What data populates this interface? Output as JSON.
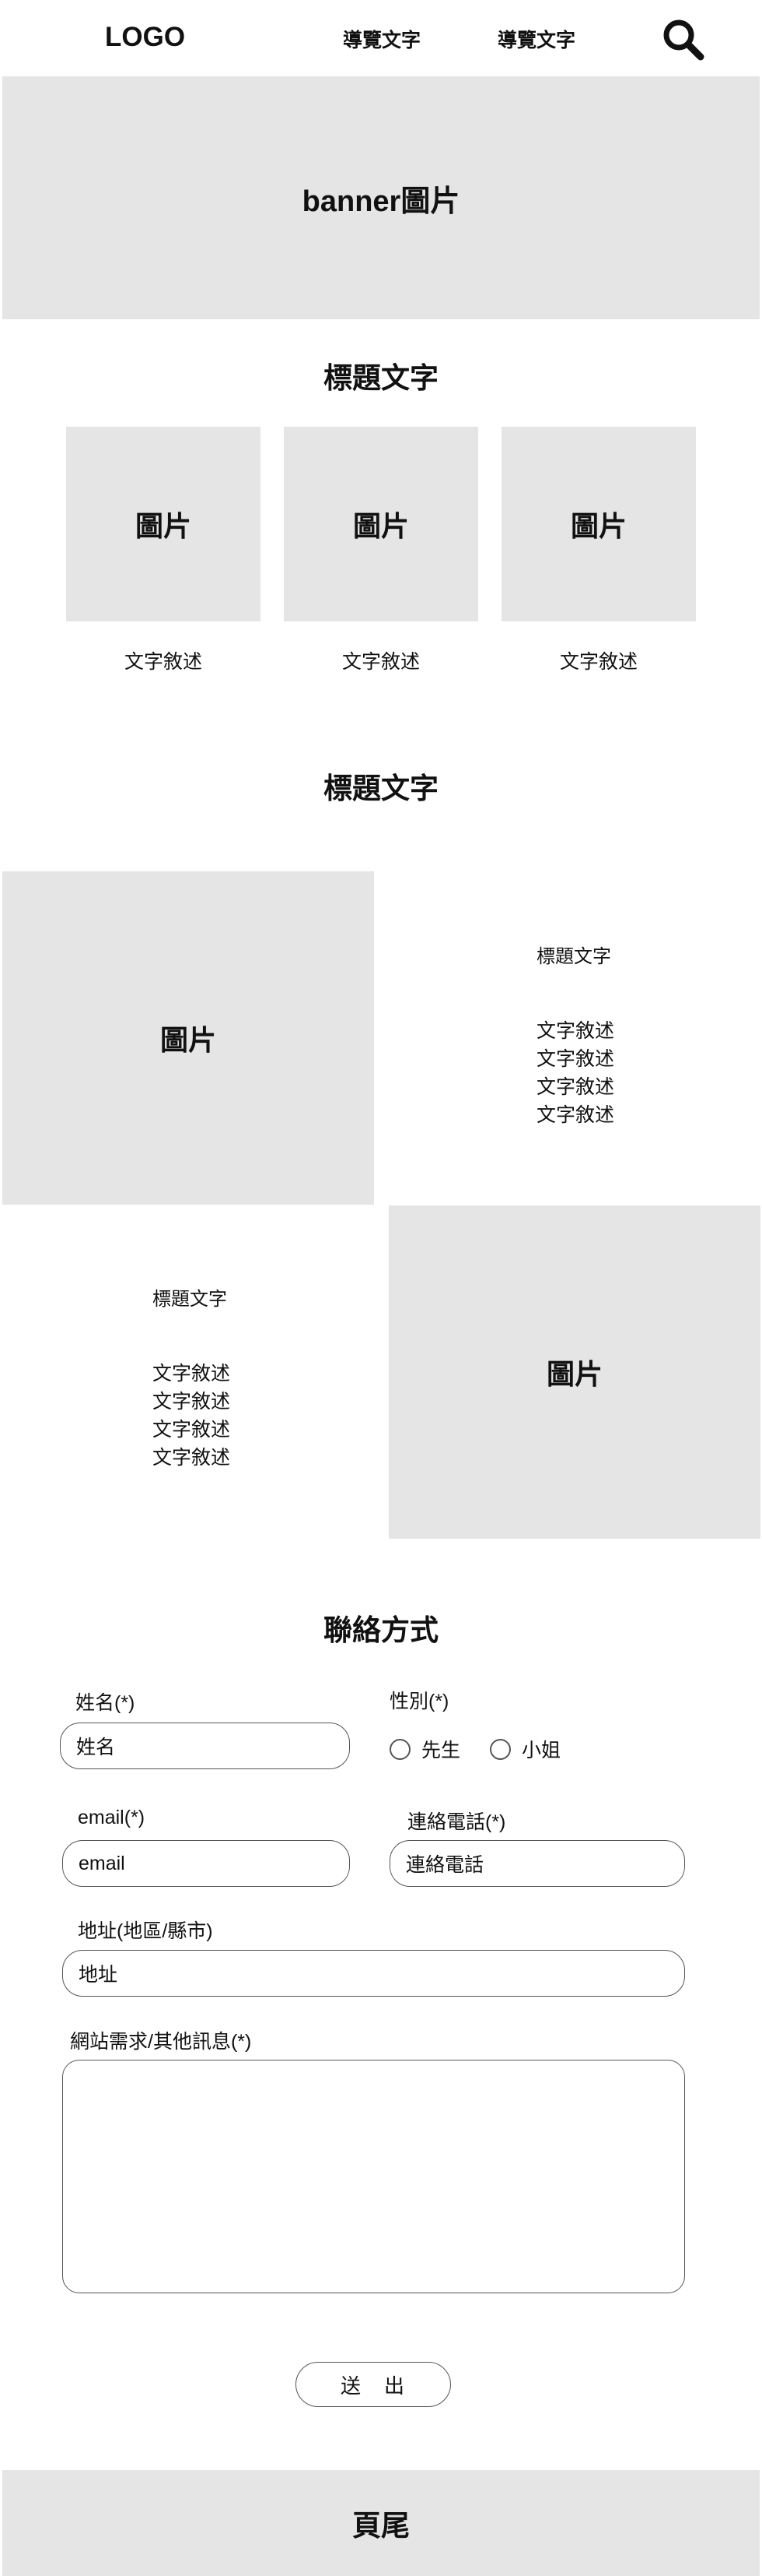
{
  "header": {
    "logo": "LOGO",
    "nav": [
      "導覽文字",
      "導覽文字"
    ],
    "search_icon": "search-icon"
  },
  "banner": {
    "label": "banner圖片"
  },
  "section1": {
    "title": "標題文字",
    "cards": [
      {
        "image_label": "圖片",
        "text": "文字敘述"
      },
      {
        "image_label": "圖片",
        "text": "文字敘述"
      },
      {
        "image_label": "圖片",
        "text": "文字敘述"
      }
    ]
  },
  "section2": {
    "title": "標題文字",
    "rows": [
      {
        "image_label": "圖片",
        "title": "標題文字",
        "lines": [
          "文字敘述",
          "文字敘述",
          "文字敘述",
          "文字敘述"
        ]
      },
      {
        "image_label": "圖片",
        "title": "標題文字",
        "lines": [
          "文字敘述",
          "文字敘述",
          "文字敘述",
          "文字敘述"
        ]
      }
    ]
  },
  "contact": {
    "title": "聯絡方式",
    "name": {
      "label": "姓名(*)",
      "placeholder": "姓名"
    },
    "gender": {
      "label": "性別(*)",
      "options": [
        "先生",
        "小姐"
      ]
    },
    "email": {
      "label": "email(*)",
      "placeholder": "email"
    },
    "phone": {
      "label": "連絡電話(*)",
      "placeholder": "連絡電話"
    },
    "address": {
      "label": "地址(地區/縣市)",
      "placeholder": "地址"
    },
    "message": {
      "label": "網站需求/其他訊息(*)",
      "placeholder": ""
    },
    "submit": "送　出"
  },
  "footer": {
    "label": "頁尾"
  }
}
